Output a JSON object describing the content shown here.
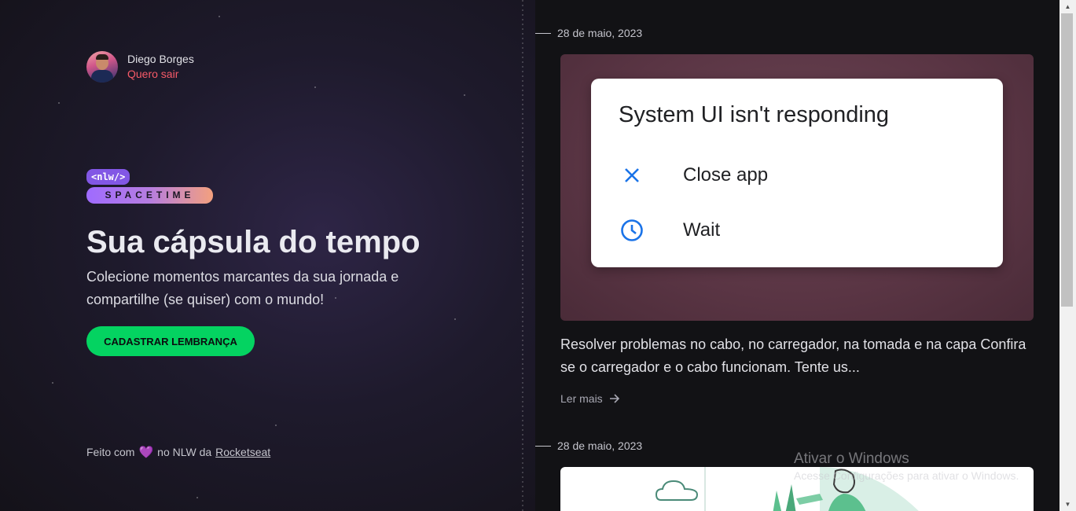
{
  "user": {
    "name": "Diego Borges",
    "logout_label": "Quero sair"
  },
  "brand": {
    "tag": "<nlw/>",
    "word": "SPACETIME"
  },
  "hero": {
    "title": "Sua cápsula do tempo",
    "subtitle": "Colecione momentos marcantes da sua jornada e compartilhe (se quiser) com o mundo!",
    "cta_label": "CADASTRAR LEMBRANÇA"
  },
  "footer": {
    "prefix": "Feito com",
    "middle": "no NLW da",
    "link": "Rocketseat"
  },
  "memories": [
    {
      "date": "28 de maio, 2023",
      "image_dialog": {
        "title": "System UI isn't responding",
        "option1": "Close app",
        "option2": "Wait"
      },
      "excerpt": "Resolver problemas no cabo, no carregador, na tomada e na capa Confira se o carregador e o cabo funcionam. Tente us...",
      "read_more": "Ler mais"
    },
    {
      "date": "28 de maio, 2023"
    }
  ],
  "watermark": {
    "title": "Ativar o Windows",
    "subtitle": "Acesse Configurações para ativar o Windows."
  },
  "colors": {
    "accent_green": "#04d361",
    "logout_red": "#f75a68",
    "brand_purple": "#8257e5"
  }
}
